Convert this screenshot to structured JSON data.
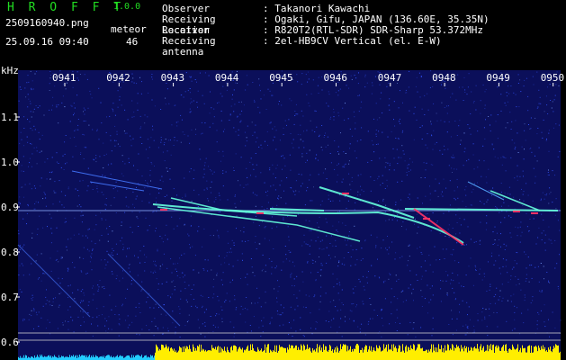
{
  "header": {
    "logo": "H R O F F T",
    "version": "1.0.0",
    "filename": "2509160940.png",
    "datetime": "25.09.16 09:40",
    "meteor_label": "meteor",
    "meteor_count": "46"
  },
  "info": [
    {
      "key": "Observer",
      "value": ": Takanori Kawachi"
    },
    {
      "key": "Receiving Location",
      "value": ": Ogaki, Gifu, JAPAN (136.60E, 35.35N)"
    },
    {
      "key": "Receiver",
      "value": ": R820T2(RTL-SDR) SDR-Sharp 53.372MHz"
    },
    {
      "key": "Receiving antenna",
      "value": ": 2el-HB9CV Vertical (el. E-W)"
    }
  ],
  "axes": {
    "y_unit": "kHz",
    "y_ticks": [
      "1.1",
      "1.0",
      "0.9",
      "0.8",
      "0.7",
      "0.6"
    ],
    "x_ticks": [
      "0941",
      "0942",
      "0943",
      "0944",
      "0945",
      "0946",
      "0947",
      "0948",
      "0949",
      "0950"
    ]
  },
  "colors": {
    "background": "#000000",
    "spectrogram_bg": "#0b0f5a",
    "noise": "#3355ff",
    "signal": "#66ffdd",
    "hot": "#ff3366",
    "power_bar": "#ffee00",
    "power_low": "#22ccff"
  }
}
